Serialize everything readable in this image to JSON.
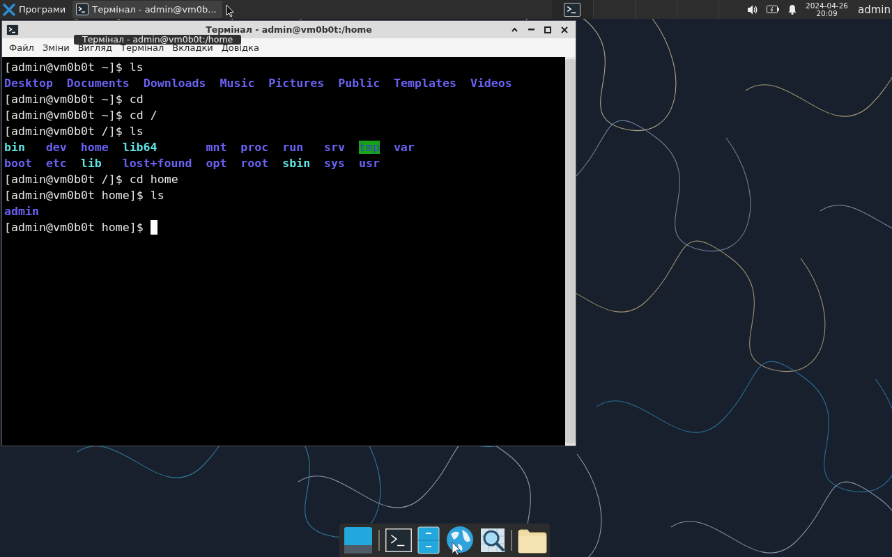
{
  "top_panel": {
    "app_menu": {
      "label": "Програми"
    },
    "tasks": [
      {
        "label": "Термінал - admin@vm0b...",
        "selected": true
      }
    ],
    "workspaces": [
      {
        "selected": true
      },
      {
        "selected": false
      },
      {
        "selected": false
      },
      {
        "selected": false
      }
    ],
    "clock": {
      "date": "2024-04-26",
      "time": "20:09"
    },
    "user": "admin"
  },
  "window": {
    "title": "Термінал - admin@vm0b0t:/home",
    "menu": [
      "Файл",
      "Зміни",
      "Вигляд",
      "Термінал",
      "Вкладки",
      "Довідка"
    ],
    "lines": [
      {
        "kind": "command",
        "prompt": "[admin@vm0b0t ~]$",
        "command": "ls"
      },
      {
        "kind": "listing",
        "rows": [
          [
            {
              "name": "Desktop",
              "kind": "dir"
            },
            {
              "name": "Documents",
              "kind": "dir"
            },
            {
              "name": "Downloads",
              "kind": "dir"
            },
            {
              "name": "Music",
              "kind": "dir"
            },
            {
              "name": "Pictures",
              "kind": "dir"
            },
            {
              "name": "Public",
              "kind": "dir"
            },
            {
              "name": "Templates",
              "kind": "dir"
            },
            {
              "name": "Videos",
              "kind": "dir"
            }
          ]
        ]
      },
      {
        "kind": "command",
        "prompt": "[admin@vm0b0t ~]$",
        "command": "cd"
      },
      {
        "kind": "command",
        "prompt": "[admin@vm0b0t ~]$",
        "command": "cd /"
      },
      {
        "kind": "command",
        "prompt": "[admin@vm0b0t /]$",
        "command": "ls"
      },
      {
        "kind": "listing",
        "rows": [
          [
            {
              "name": "bin",
              "kind": "link"
            },
            {
              "name": "dev",
              "kind": "dir"
            },
            {
              "name": "home",
              "kind": "dir"
            },
            {
              "name": "lib64",
              "kind": "link"
            },
            {
              "name": "mnt",
              "kind": "dir"
            },
            {
              "name": "proc",
              "kind": "dir"
            },
            {
              "name": "run",
              "kind": "dir"
            },
            {
              "name": "srv",
              "kind": "dir"
            },
            {
              "name": "tmp",
              "kind": "sticky"
            },
            {
              "name": "var",
              "kind": "dir"
            }
          ],
          [
            {
              "name": "boot",
              "kind": "dir"
            },
            {
              "name": "etc",
              "kind": "dir"
            },
            {
              "name": "lib",
              "kind": "link"
            },
            {
              "name": "lost+found",
              "kind": "dir"
            },
            {
              "name": "opt",
              "kind": "dir"
            },
            {
              "name": "root",
              "kind": "dir"
            },
            {
              "name": "sbin",
              "kind": "link"
            },
            {
              "name": "sys",
              "kind": "dir"
            },
            {
              "name": "usr",
              "kind": "dir"
            }
          ]
        ]
      },
      {
        "kind": "command",
        "prompt": "[admin@vm0b0t /]$",
        "command": "cd home"
      },
      {
        "kind": "command",
        "prompt": "[admin@vm0b0t home]$",
        "command": "ls"
      },
      {
        "kind": "listing",
        "rows": [
          [
            {
              "name": "admin",
              "kind": "dir"
            }
          ]
        ]
      },
      {
        "kind": "input",
        "prompt": "[admin@vm0b0t home]$"
      }
    ]
  },
  "tooltip": {
    "text": "Термінал - admin@vm0b0t:/home"
  }
}
